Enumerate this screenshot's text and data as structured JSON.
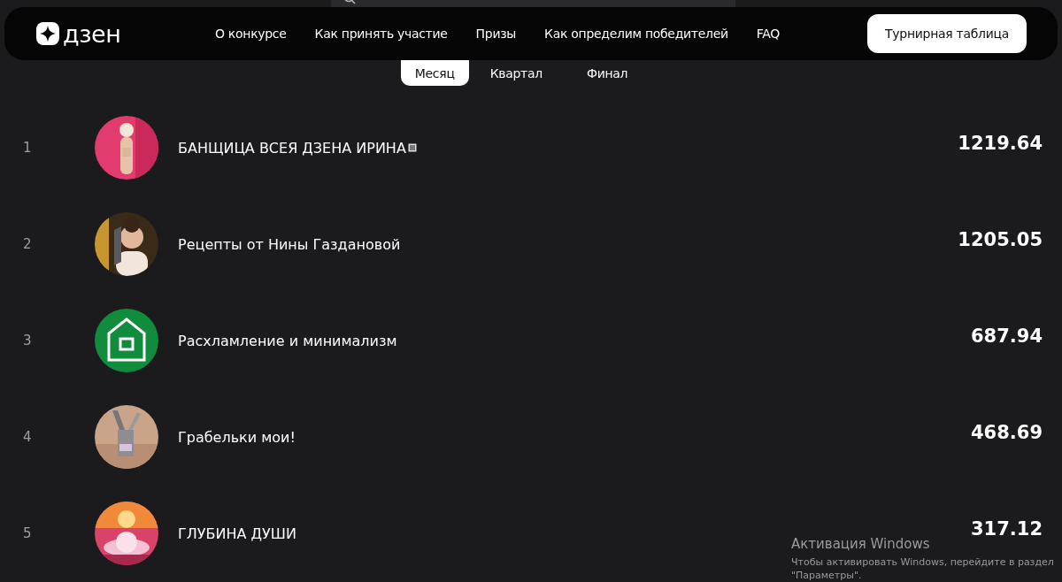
{
  "nav": {
    "logo": "дзен",
    "links": [
      "О конкурсе",
      "Как принять участие",
      "Призы",
      "Как определим победителей",
      "FAQ"
    ],
    "button": "Турнирная таблица"
  },
  "tabs": [
    {
      "label": "Месяц",
      "selected": true
    },
    {
      "label": "Квартал",
      "selected": false
    },
    {
      "label": "Финал",
      "selected": false
    }
  ],
  "rows": [
    {
      "rank": "1",
      "name": "БАНЩИЦА ВСЕЯ ДЗЕНА ИРИНА",
      "score": "1219.64"
    },
    {
      "rank": "2",
      "name": "Рецепты от Нины Газдановой",
      "score": "1205.05"
    },
    {
      "rank": "3",
      "name": "Расхламление и минимализм",
      "score": "687.94"
    },
    {
      "rank": "4",
      "name": "Грабельки мои!",
      "score": "468.69"
    },
    {
      "rank": "5",
      "name": "ГЛУБИНА ДУШИ",
      "score": "317.12"
    }
  ],
  "activation": {
    "title": "Активация Windows",
    "text": "Чтобы активировать Windows, перейдите в раздел \"Параметры\"."
  }
}
